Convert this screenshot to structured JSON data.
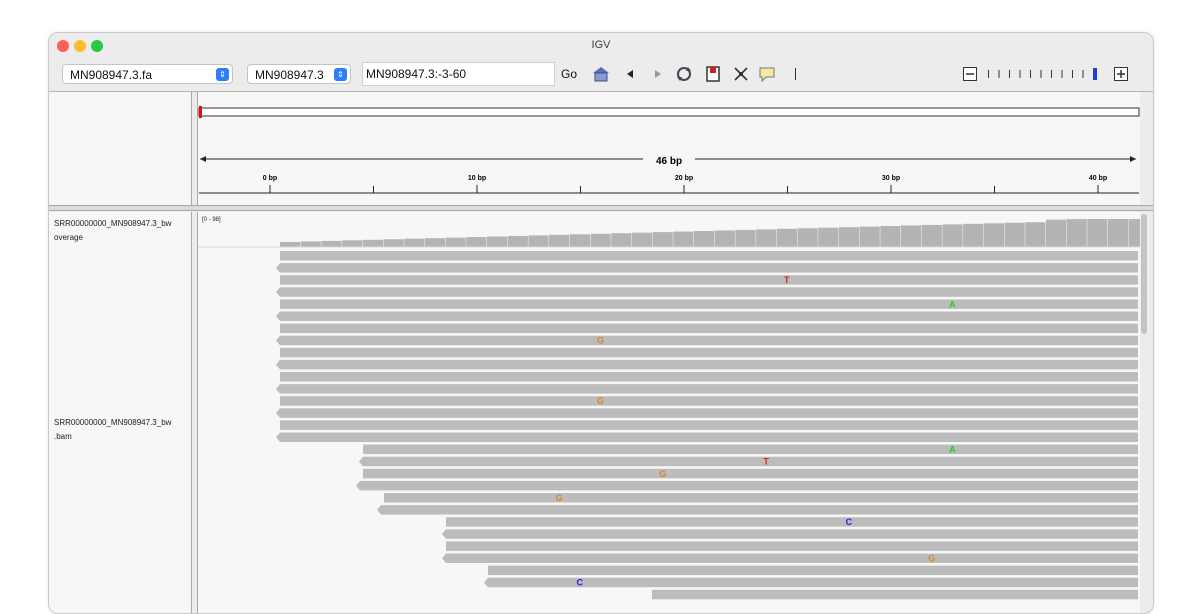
{
  "window": {
    "title": "IGV"
  },
  "toolbar": {
    "genome": "MN908947.3.fa",
    "chromosome": "MN908947.3",
    "locus": "MN908947.3:-3-60",
    "go_label": "Go",
    "icons": [
      "home-icon",
      "back-icon",
      "forward-icon",
      "refresh-icon",
      "region-icon",
      "resize-icon",
      "popup-text-icon"
    ]
  },
  "ruler": {
    "span_label": "46 bp",
    "ticks": [
      "0 bp",
      "10 bp",
      "20 bp",
      "30 bp",
      "40 bp"
    ]
  },
  "tracks": {
    "coverage": {
      "line1": "SRR00000000_MN908947.3_bw",
      "line2": "overage",
      "range": "[0 - 98]"
    },
    "alignment": {
      "line1": "SRR00000000_MN908947.3_bw",
      "line2": ".bam"
    }
  },
  "mismatches": [
    {
      "base": "T",
      "row": 2,
      "pos": 24
    },
    {
      "base": "A",
      "row": 4,
      "pos": 32
    },
    {
      "base": "G",
      "row": 7,
      "pos": 15
    },
    {
      "base": "G",
      "row": 12,
      "pos": 15
    },
    {
      "base": "A",
      "row": 16,
      "pos": 32
    },
    {
      "base": "T",
      "row": 17,
      "pos": 23
    },
    {
      "base": "G",
      "row": 18,
      "pos": 18
    },
    {
      "base": "G",
      "row": 20,
      "pos": 13
    },
    {
      "base": "C",
      "row": 22,
      "pos": 27
    },
    {
      "base": "G",
      "row": 25,
      "pos": 31
    },
    {
      "base": "C",
      "row": 27,
      "pos": 14
    }
  ],
  "colors": {
    "A": "#22cc22",
    "C": "#2222dd",
    "G": "#d9822b",
    "T": "#dd2222",
    "read": "#bcbcbc",
    "coverage": "#b4b4b4"
  }
}
